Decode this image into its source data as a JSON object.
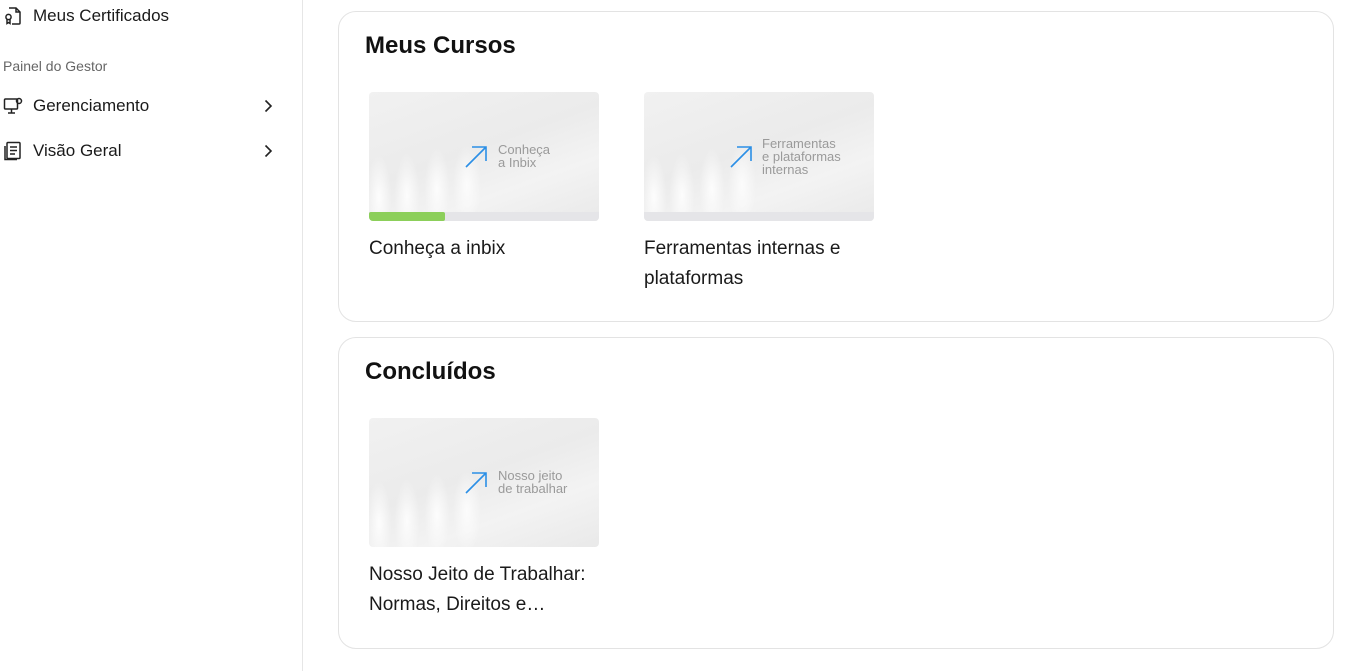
{
  "sidebar": {
    "certificates_label": "Meus Certificados",
    "section_label": "Painel do Gestor",
    "management_label": "Gerenciamento",
    "overview_label": "Visão Geral"
  },
  "my_courses": {
    "title": "Meus Cursos",
    "courses": [
      {
        "thumb_text": "Conheça\na Inbix",
        "title": "Conheça a inbix",
        "progress": 0.33
      },
      {
        "thumb_text": "Ferramentas\ne plataformas\ninternas",
        "title": "Ferramentas internas e plataformas",
        "progress": 0
      }
    ]
  },
  "completed": {
    "title": "Concluídos",
    "courses": [
      {
        "thumb_text": "Nosso jeito\nde trabalhar",
        "title": "Nosso Jeito de Trabalhar: Normas, Direitos e…"
      }
    ]
  },
  "colors": {
    "arrow": "#2b8fe6",
    "progress_fill": "#8ccf5a",
    "progress_track": "#e5e5e8"
  }
}
